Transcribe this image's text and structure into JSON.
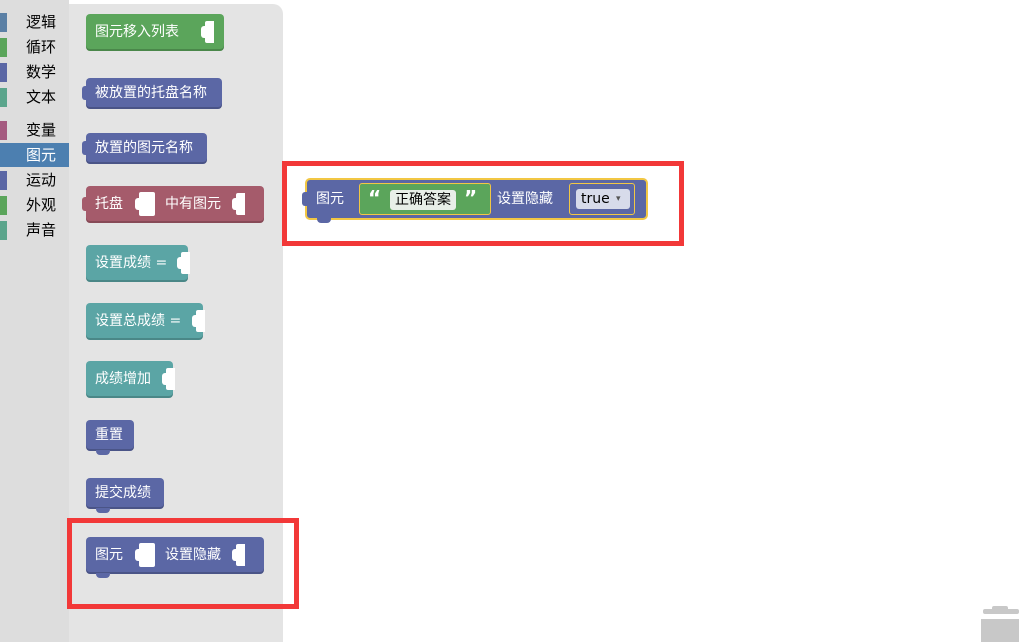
{
  "categories": [
    {
      "label": "逻辑",
      "color": "#5b80a5"
    },
    {
      "label": "循环",
      "color": "#5ba55b"
    },
    {
      "label": "数学",
      "color": "#5b67a5"
    },
    {
      "label": "文本",
      "color": "#5ba58c"
    },
    {
      "label": "变量",
      "color": "#a55b80"
    },
    {
      "label": "图元",
      "color": "#4c7fb0"
    },
    {
      "label": "运动",
      "color": "#5b67a5"
    },
    {
      "label": "外观",
      "color": "#5ba55b"
    },
    {
      "label": "声音",
      "color": "#5ba58c"
    }
  ],
  "selected_category": "图元",
  "flyout_blocks": [
    {
      "label": "图元移入列表",
      "color": "#5ba55b"
    },
    {
      "label": "被放置的托盘名称",
      "color": "#5b67a5"
    },
    {
      "label": "放置的图元名称",
      "color": "#5b67a5"
    },
    {
      "label": "托盘",
      "label2": "中有图元",
      "color": "#a55b6b"
    },
    {
      "label": "设置成绩 =",
      "color": "#5ba5a5"
    },
    {
      "label": "设置总成绩 =",
      "color": "#5ba5a5"
    },
    {
      "label": "成绩增加",
      "color": "#5ba5a5"
    },
    {
      "label": "重置",
      "color": "#5b67a5"
    },
    {
      "label": "提交成绩",
      "color": "#5b67a5"
    },
    {
      "label": "图元",
      "label2": "设置隐藏",
      "color": "#5b67a5"
    }
  ],
  "workspace_block": {
    "label_prefix": "图元",
    "open_quote": "“",
    "text_value": "正确答案",
    "close_quote": "”",
    "label_action": "设置隐藏",
    "bool_value": "true",
    "dropdown_arrow": "▾"
  },
  "highlight_color": "#f23838",
  "icons": [
    "trash-can-icon"
  ]
}
